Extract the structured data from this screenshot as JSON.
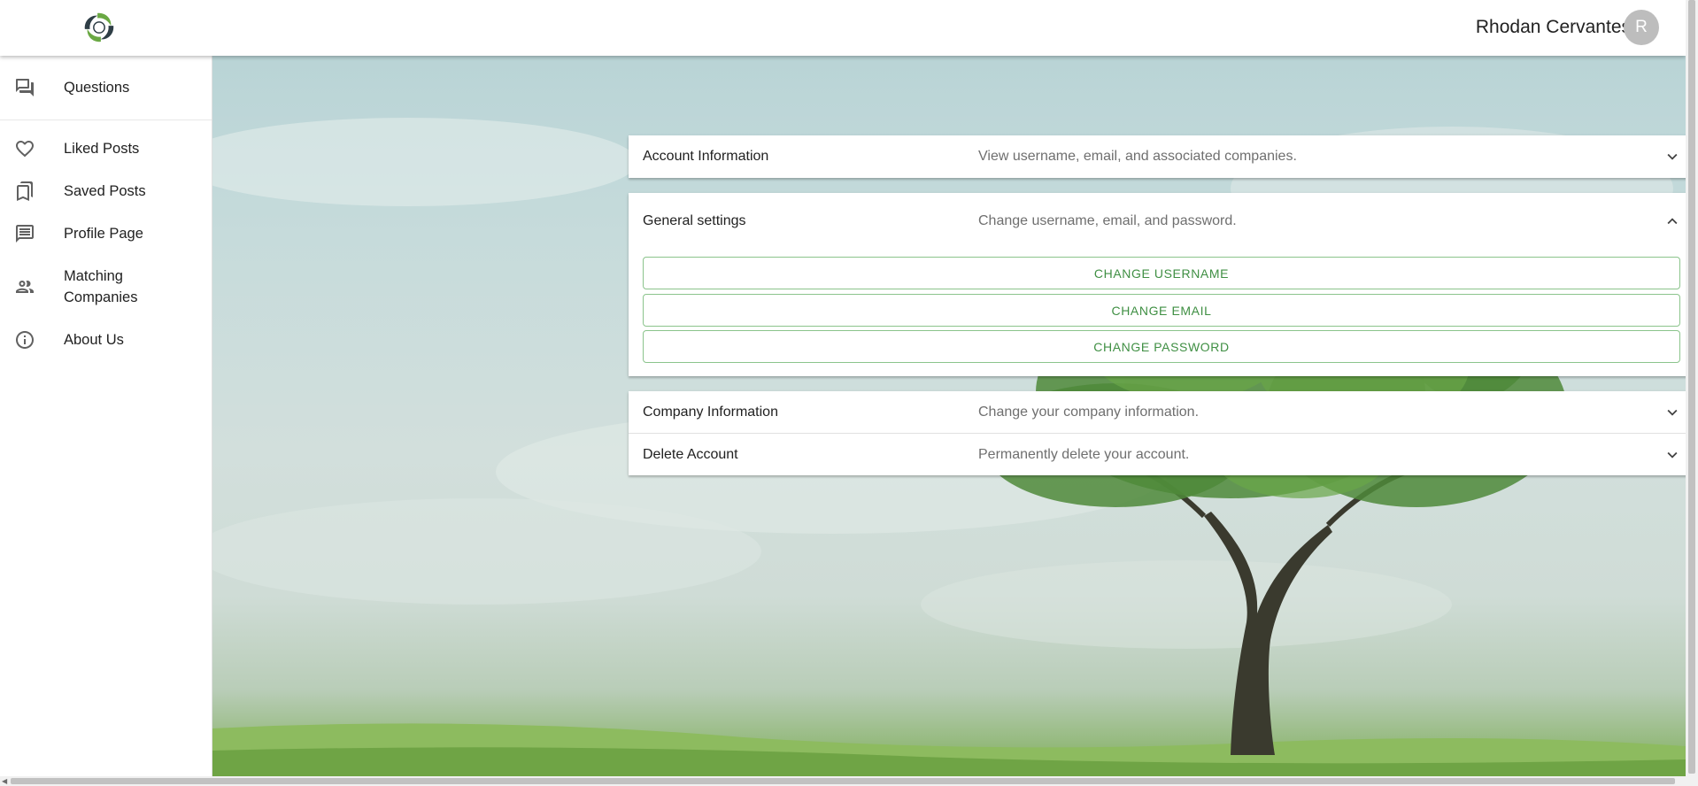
{
  "header": {
    "user_name": "Rhodan Cervantes",
    "avatar_initial": "R"
  },
  "sidebar": {
    "items": [
      {
        "label": "Questions",
        "icon": "forum-icon"
      },
      {
        "label": "Liked Posts",
        "icon": "heart-outline-icon"
      },
      {
        "label": "Saved Posts",
        "icon": "bookmarks-icon"
      },
      {
        "label": "Profile Page",
        "icon": "chat-box-icon"
      },
      {
        "label": "Matching Companies",
        "icon": "people-icon"
      },
      {
        "label": "About Us",
        "icon": "info-outline-icon"
      }
    ]
  },
  "settings": {
    "sections": [
      {
        "title": "Account Information",
        "description": "View username, email, and associated companies.",
        "expanded": false
      },
      {
        "title": "General settings",
        "description": "Change username, email, and password.",
        "expanded": true,
        "actions": [
          "Change Username",
          "Change Email",
          "Change Password"
        ]
      },
      {
        "title": "Company Information",
        "description": "Change your company information.",
        "expanded": false
      },
      {
        "title": "Delete Account",
        "description": "Permanently delete your account.",
        "expanded": false
      }
    ]
  },
  "colors": {
    "accent": "#3f8f43",
    "button_border": "#8bc48c",
    "avatar_bg": "#bdbdbd"
  }
}
